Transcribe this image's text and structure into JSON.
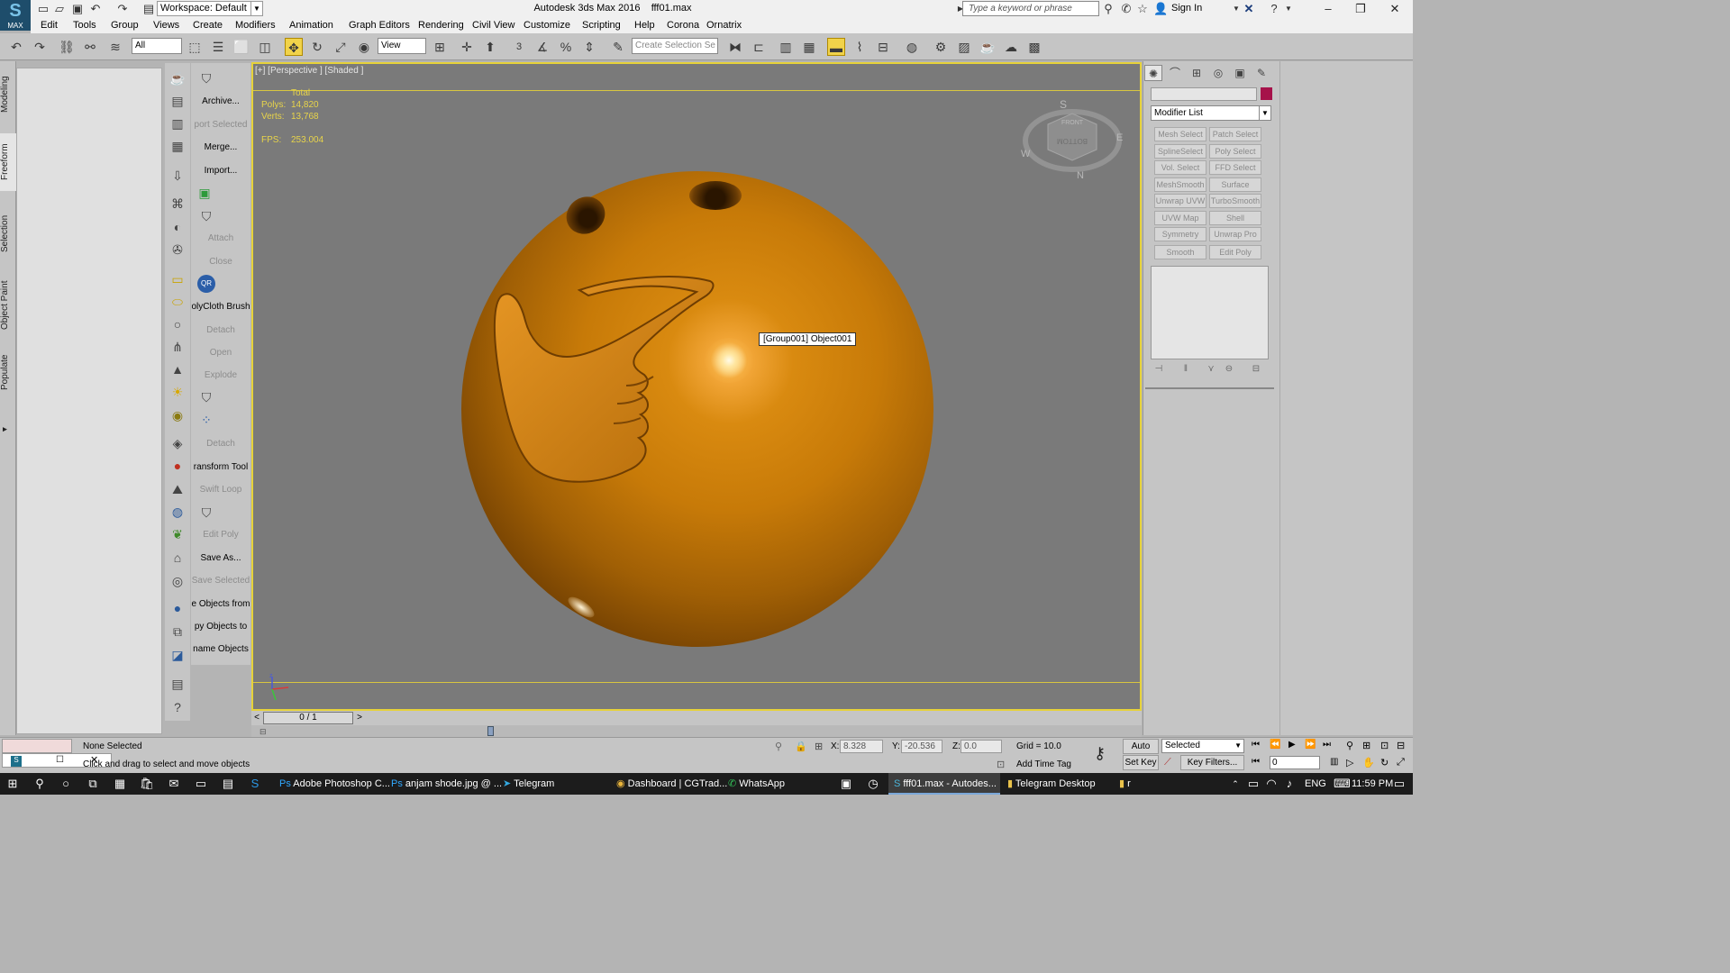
{
  "titlebar": {
    "workspace_label": "Workspace: Default",
    "app_title": "Autodesk 3ds Max 2016",
    "file_name": "fff01.max",
    "search_placeholder": "Type a keyword or phrase",
    "signin_label": "Sign In",
    "logo_text": "MAX"
  },
  "menu": [
    "Edit",
    "Tools",
    "Group",
    "Views",
    "Create",
    "Modifiers",
    "Animation",
    "Graph Editors",
    "Rendering",
    "Civil View",
    "Customize",
    "Scripting",
    "Help",
    "Corona",
    "Ornatrix"
  ],
  "toolbar": {
    "selection_filter": "All",
    "ref_coord": "View",
    "named_selection": "Create Selection Se",
    "snap_3": "3"
  },
  "left_tabs": [
    "Modeling",
    "Freeform",
    "Selection",
    "Object Paint",
    "Populate"
  ],
  "side_labels": [
    {
      "text": "Archive...",
      "disabled": false
    },
    {
      "text": "port Selected",
      "disabled": true
    },
    {
      "text": "Merge...",
      "disabled": false
    },
    {
      "text": "Import...",
      "disabled": false
    },
    {
      "text": "Attach",
      "disabled": true
    },
    {
      "text": "Close",
      "disabled": true
    },
    {
      "text": "olyCloth Brush",
      "disabled": false
    },
    {
      "text": "Detach",
      "disabled": true
    },
    {
      "text": "Open",
      "disabled": true
    },
    {
      "text": "Explode",
      "disabled": true
    },
    {
      "text": "Detach",
      "disabled": true
    },
    {
      "text": "ransform Tool",
      "disabled": false
    },
    {
      "text": "Swift Loop",
      "disabled": true
    },
    {
      "text": "Edit Poly",
      "disabled": true
    },
    {
      "text": "Save As...",
      "disabled": false
    },
    {
      "text": "Save Selected",
      "disabled": true
    },
    {
      "text": "e Objects from",
      "disabled": false
    },
    {
      "text": "py Objects to",
      "disabled": false
    },
    {
      "text": "name Objects",
      "disabled": false
    }
  ],
  "qr_text": "QR",
  "viewport": {
    "label": "[+] [Perspective ] [Shaded ]",
    "stats_header": "Total",
    "polys_label": "Polys:",
    "polys_value": "14,820",
    "verts_label": "Verts:",
    "verts_value": "13,768",
    "fps_label": "FPS:",
    "fps_value": "253.004",
    "tooltip": "[Group001] Object001",
    "gizmo_front": "FRONT",
    "gizmo_bottom": "BOTTOM",
    "gizmo_dirs": [
      "S",
      "W",
      "E",
      "N"
    ],
    "axis_z": "z"
  },
  "command_panel": {
    "modifier_list": "Modifier List",
    "modifiers": [
      "Mesh Select",
      "Patch Select",
      "SplineSelect",
      "Poly Select",
      "Vol. Select",
      "FFD Select",
      "MeshSmooth",
      "Surface Select",
      "Unwrap UVW",
      "TurboSmooth",
      "UVW Map",
      "Shell",
      "Symmetry",
      "Unwrap Pro",
      "Smooth",
      "Edit Poly"
    ],
    "object_color": "#a6124a"
  },
  "timeline": {
    "frame": "0 / 1",
    "prev": "<",
    "next": ">"
  },
  "status": {
    "selection": "None Selected",
    "prompt": "Click and drag to select and move objects",
    "x_label": "X:",
    "x_value": "8.328",
    "y_label": "Y:",
    "y_value": "-20.536",
    "z_label": "Z:",
    "z_value": "0.0",
    "grid": "Grid = 10.0",
    "add_time_tag": "Add Time Tag",
    "auto_key": "Auto Key",
    "set_key": "Set Key",
    "selected_option": "Selected",
    "key_filters": "Key Filters...",
    "frame_value": "0"
  },
  "taskbar": {
    "apps": [
      "Adobe Photoshop C...",
      "anjam shode.jpg @ ...",
      "Telegram",
      "Dashboard | CGTrad...",
      "WhatsApp",
      "fff01.max - Autodes...",
      "Telegram Desktop",
      "r"
    ],
    "lang": "ENG",
    "time": "11:59 PM"
  },
  "colors": {
    "viewport_border": "#e6d23a",
    "stats_text": "#e8d44a",
    "ball": "#c77a08"
  }
}
